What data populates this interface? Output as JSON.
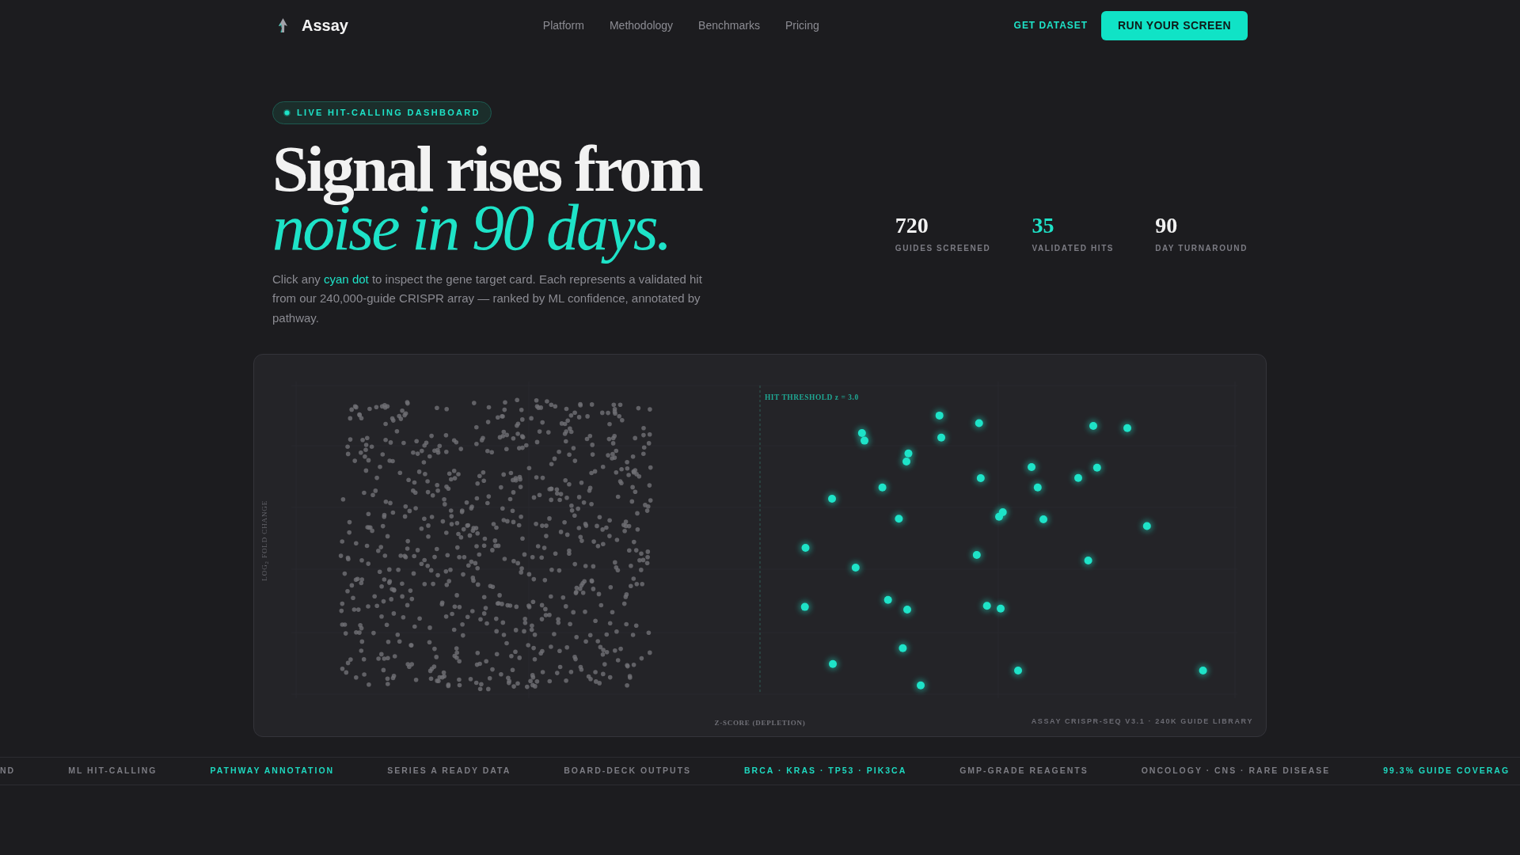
{
  "nav": {
    "brand": "Assay",
    "links": [
      "Platform",
      "Methodology",
      "Benchmarks",
      "Pricing"
    ],
    "secondary_action": "GET DATASET",
    "primary_action": "RUN YOUR SCREEN"
  },
  "hero": {
    "badge": "LIVE HIT-CALLING DASHBOARD",
    "headline": [
      {
        "text": "Signal rises from",
        "kind": "plain"
      },
      {
        "text": "noise in 90 days.",
        "kind": "accent"
      }
    ],
    "intro": [
      {
        "text": "Click any ",
        "kind": "plain"
      },
      {
        "text": "cyan dot",
        "kind": "accent"
      },
      {
        "text": " to inspect the gene target card. Each represents a validated hit from our 240,000-guide CRISPR array — ranked by ML confidence, annotated by pathway.",
        "kind": "plain"
      }
    ]
  },
  "stats": [
    {
      "value": "720",
      "label": "GUIDES SCREENED",
      "color": "#f2f2f2"
    },
    {
      "value": "35",
      "label": "VALIDATED HITS",
      "color": "#1ee3c8"
    },
    {
      "value": "90",
      "label": "DAY TURNAROUND",
      "color": "#f2f2f2"
    }
  ],
  "chart": {
    "y_axis_label": "LOG$_{2}$ FOLD CHANGE",
    "threshold_label": "HIT THRESHOLD z = 3.0",
    "x_axis_label": "Z-SCORE (DEPLETION)",
    "footnote": "ASSAY CRISPR-SEQ V3.1 · 240K GUIDE LIBRARY"
  },
  "ticker": [
    {
      "text": "ND",
      "color": "#7d7d84"
    },
    {
      "text": "ML HIT-CALLING",
      "color": "#7d7d84"
    },
    {
      "text": "PATHWAY ANNOTATION",
      "color": "#1ed9c0"
    },
    {
      "text": "SERIES A READY DATA",
      "color": "#7d7d84"
    },
    {
      "text": "BOARD-DECK OUTPUTS",
      "color": "#7d7d84"
    },
    {
      "text": "BRCA · KRAS · TP53 · PIK3CA",
      "color": "#1ed9c0"
    },
    {
      "text": "GMP-GRADE REAGENTS",
      "color": "#7d7d84"
    },
    {
      "text": "ONCOLOGY · CNS · RARE DISEASE",
      "color": "#7d7d84"
    },
    {
      "text": "99.3% GUIDE COVERAG",
      "color": "#1ed9c0"
    }
  ]
}
